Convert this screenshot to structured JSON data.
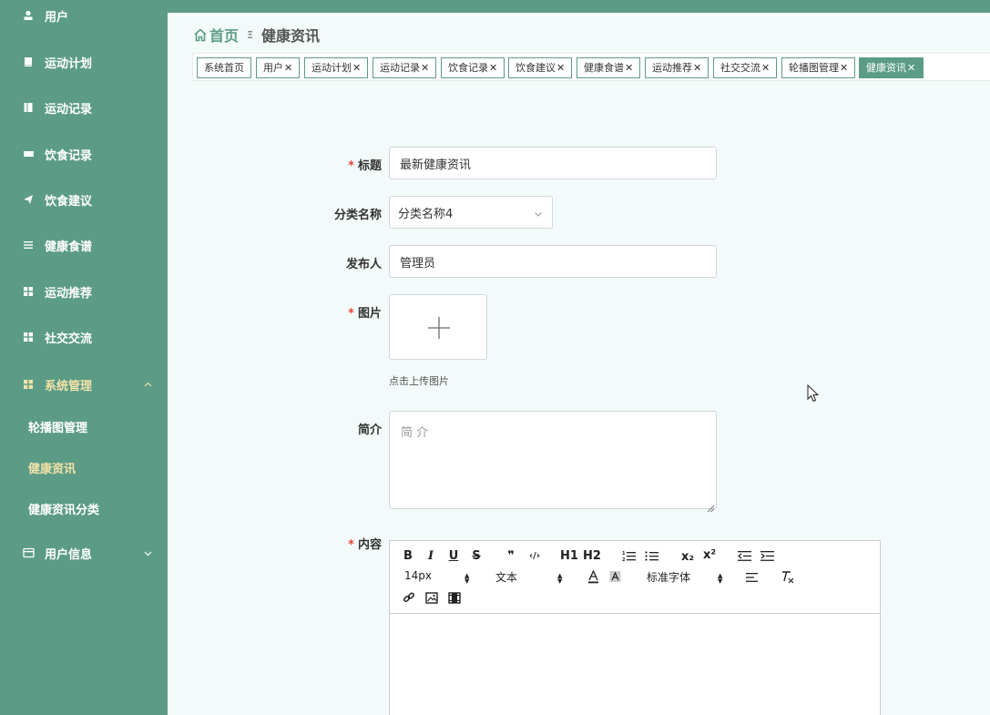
{
  "sidebar": {
    "items": [
      {
        "label": "用户",
        "icon": "user-icon"
      },
      {
        "label": "运动计划",
        "icon": "book-icon"
      },
      {
        "label": "运动记录",
        "icon": "notebook-icon"
      },
      {
        "label": "饮食记录",
        "icon": "ticket-icon"
      },
      {
        "label": "饮食建议",
        "icon": "send-icon"
      },
      {
        "label": "健康食谱",
        "icon": "list-icon"
      },
      {
        "label": "运动推荐",
        "icon": "grid-icon"
      },
      {
        "label": "社交交流",
        "icon": "grid-icon"
      },
      {
        "label": "系统管理",
        "icon": "grid-icon"
      },
      {
        "label": "用户信息",
        "icon": "card-icon"
      }
    ],
    "sub_items": [
      {
        "label": "轮播图管理"
      },
      {
        "label": "健康资讯"
      },
      {
        "label": "健康资讯分类"
      }
    ]
  },
  "breadcrumb": {
    "home": "首页",
    "separator": "Ξ",
    "current": "健康资讯"
  },
  "tabs": [
    {
      "label": "系统首页",
      "closable": false
    },
    {
      "label": "用户",
      "closable": true
    },
    {
      "label": "运动计划",
      "closable": true
    },
    {
      "label": "运动记录",
      "closable": true
    },
    {
      "label": "饮食记录",
      "closable": true
    },
    {
      "label": "饮食建议",
      "closable": true
    },
    {
      "label": "健康食谱",
      "closable": true
    },
    {
      "label": "运动推荐",
      "closable": true
    },
    {
      "label": "社交交流",
      "closable": true
    },
    {
      "label": "轮播图管理",
      "closable": true
    },
    {
      "label": "健康资讯",
      "closable": true,
      "active": true
    }
  ],
  "form": {
    "title_label": "标题",
    "title_value": "最新健康资讯",
    "category_label": "分类名称",
    "category_value": "分类名称4",
    "publisher_label": "发布人",
    "publisher_value": "管理员",
    "image_label": "图片",
    "image_hint": "点击上传图片",
    "intro_label": "简介",
    "intro_placeholder": "简 介",
    "content_label": "内容",
    "required_mark": "*"
  },
  "editor_toolbar": {
    "font_size": "14px",
    "header": "文本",
    "font_family": "标准字体",
    "buttons": [
      "B",
      "I",
      "U",
      "S",
      "❞",
      "‹/›",
      "H1",
      "H2",
      "ordered-list",
      "bullet-list",
      "x₂",
      "x²",
      "outdent",
      "indent",
      "text-color",
      "background-color",
      "align",
      "clear-format",
      "link",
      "image",
      "video"
    ]
  },
  "colors": {
    "sidebar_bg": "#5c9c86",
    "active_menu": "#f2e2a8",
    "content_bg": "#f3fbfa",
    "required": "#e0473d"
  }
}
